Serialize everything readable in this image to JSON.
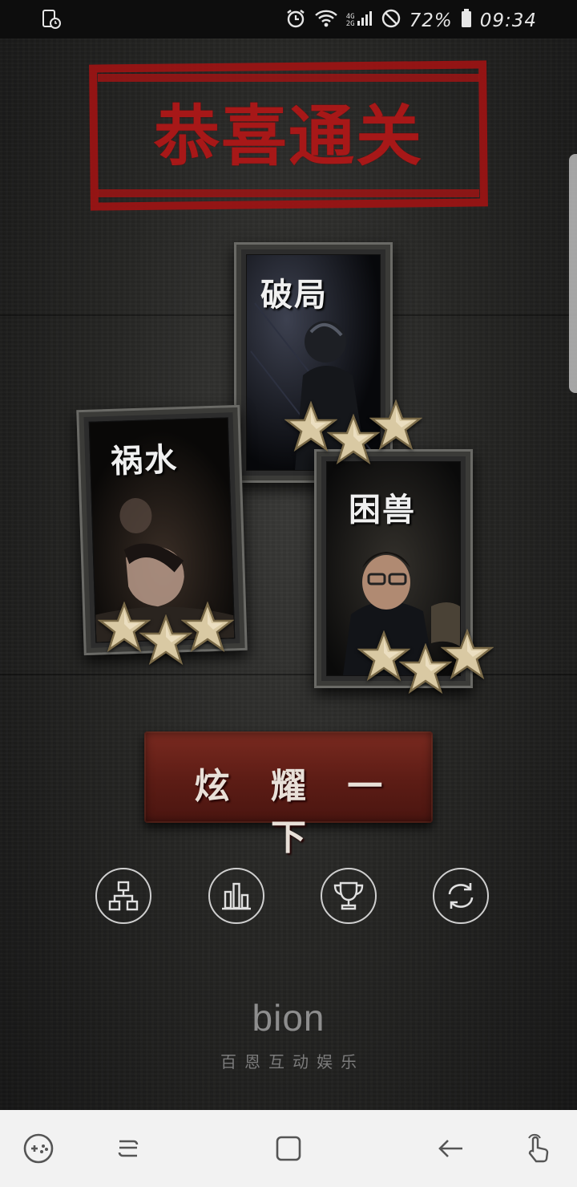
{
  "status_bar": {
    "network_top": "4G",
    "network_bottom": "2G",
    "battery": "72%",
    "time": "09:34"
  },
  "title": "恭喜通关",
  "levels": [
    {
      "name": "破局",
      "stars": 3
    },
    {
      "name": "祸水",
      "stars": 3
    },
    {
      "name": "困兽",
      "stars": 3
    }
  ],
  "share_button_label": "炫 耀 一 下",
  "icon_buttons": [
    "hierarchy-icon",
    "bar-chart-icon",
    "trophy-icon",
    "refresh-icon"
  ],
  "brand": {
    "logo": "bion",
    "subtitle": "百恩互动娱乐"
  },
  "colors": {
    "stamp_red": "#a71818",
    "button_red": "#5c1c15",
    "star_gold": "#d9c9a3"
  }
}
